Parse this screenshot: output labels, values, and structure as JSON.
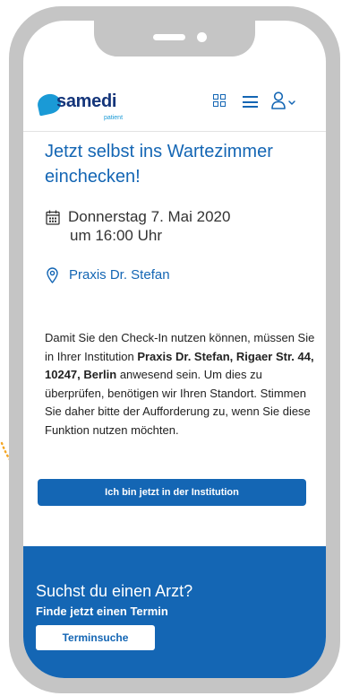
{
  "header": {
    "logo_text": "samedi",
    "logo_sub": "patient",
    "icons": [
      "grid-icon",
      "menu-icon",
      "user-icon",
      "chevron-down-icon"
    ]
  },
  "checkin": {
    "title": "Jetzt selbst ins Wartezimmer einchecken!",
    "date_line1": "Donnerstag 7. Mai 2020",
    "date_line2": "um 16:00 Uhr",
    "location": "Praxis Dr. Stefan",
    "desc_part1": "Damit Sie den Check-In nutzen können, müssen Sie in Ihrer Institution ",
    "desc_bold": "Praxis Dr. Stefan, Rigaer Str. 44, 10247, Berlin",
    "desc_part2": " anwesend sein. Um dies zu überprüfen, benötigen wir Ihren Standort. Stimmen Sie daher bitte der Aufforderung zu, wenn Sie diese Funktion nutzen möchten.",
    "button_label": "Ich bin jetzt in der Institution"
  },
  "banner": {
    "title": "Suchst du einen Arzt?",
    "subtitle": "Finde jetzt einen Termin",
    "button_label": "Terminsuche"
  },
  "colors": {
    "primary": "#1466b4",
    "logo_accent": "#1a9ad6",
    "frame": "#c5c5c5",
    "callout": "#f5a623"
  }
}
